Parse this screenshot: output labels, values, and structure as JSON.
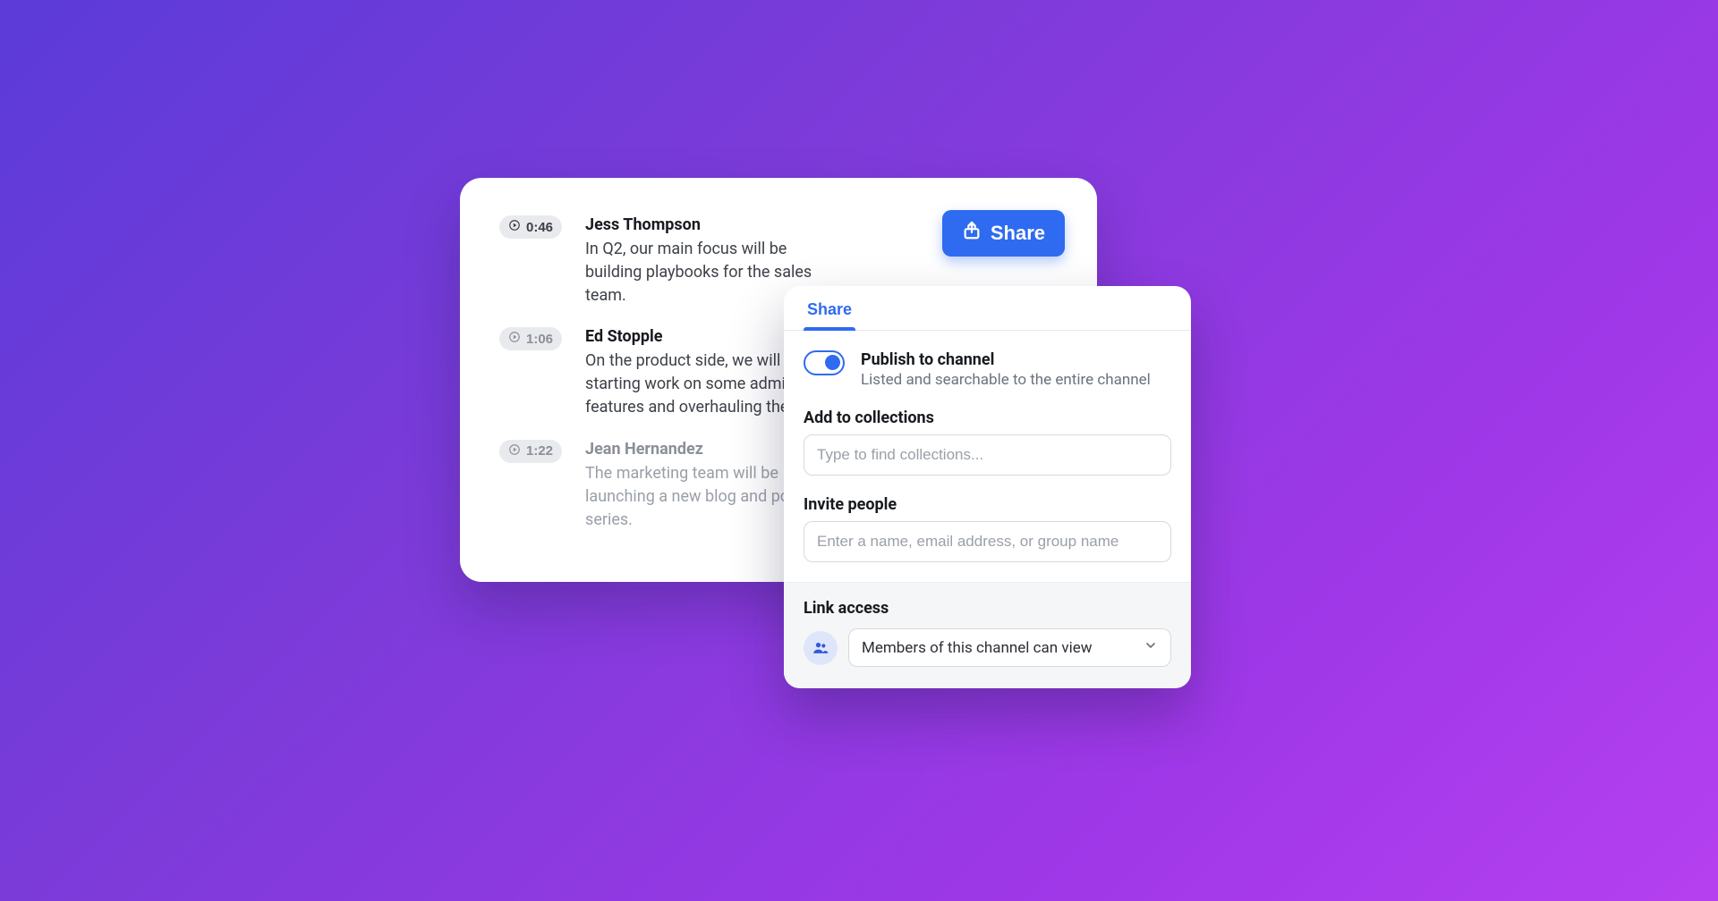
{
  "transcript": {
    "entries": [
      {
        "timestamp": "0:46",
        "speaker": "Jess Thompson",
        "text": "In Q2, our main focus will be building playbooks for the sales team.",
        "emphasis": "strong"
      },
      {
        "timestamp": "1:06",
        "speaker": "Ed Stopple",
        "text": "On the product side, we will be starting work on some admin features and overhauling the UI.",
        "emphasis": "normal"
      },
      {
        "timestamp": "1:22",
        "speaker": "Jean Hernandez",
        "text": "The marketing team will be launching a new blog and podcast series.",
        "emphasis": "dim"
      }
    ]
  },
  "share_button_label": "Share",
  "share_panel": {
    "tab_label": "Share",
    "publish": {
      "title": "Publish to channel",
      "subtitle": "Listed and searchable to the entire channel",
      "toggle_on": true
    },
    "collections": {
      "label": "Add to collections",
      "placeholder": "Type to find collections..."
    },
    "invite": {
      "label": "Invite people",
      "placeholder": "Enter a name, email address, or group name"
    },
    "link_access": {
      "label": "Link access",
      "selected": "Members of this channel can view"
    }
  }
}
